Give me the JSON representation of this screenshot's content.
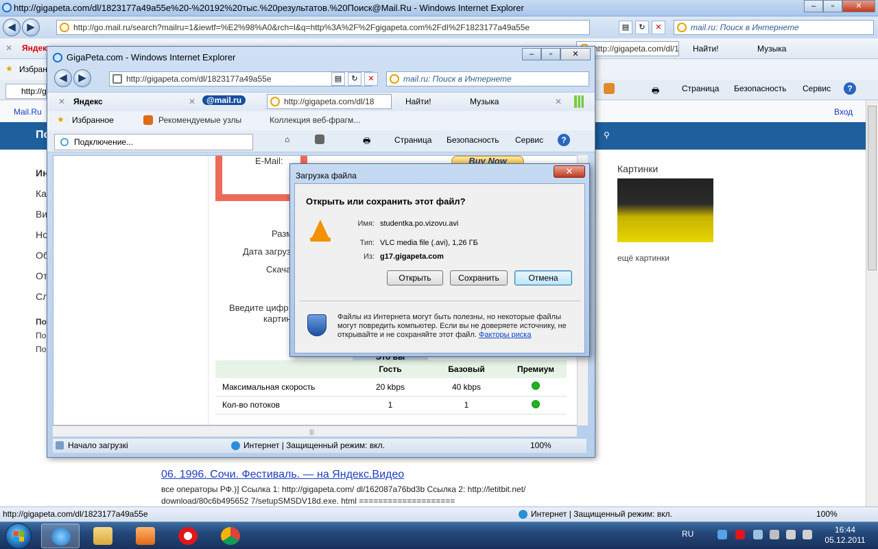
{
  "outer_window": {
    "title": "http://gigapeta.com/dl/1823177a49a55e%20-%20192%20тыс.%20результатов.%20Поиск@Mail.Ru - Windows Internet Explorer",
    "address": "http://go.mail.ru/search?mailru=1&iewtf=%E2%98%A0&rch=l&q=http%3A%2F%2Fgigapeta.com%2FdI%2F1823177a49a55e",
    "search_placeholder": "mail.ru: Поиск в Интернете",
    "yandex_label": "Яндекс",
    "toolbar_address": "http://gigapeta.com/dl/18",
    "find_label": "Найти!",
    "music_label": "Музыка",
    "fav_label": "Избранн",
    "tab_label": "http://g",
    "menu": [
      "Страница",
      "Безопасность",
      "Сервис"
    ],
    "page_brand": "Mail.Ru",
    "login": "Вход",
    "pictures_title": "Картинки",
    "pictures_more": "ещё картинки",
    "left_partial": [
      "Ин",
      "Ка",
      "Ви",
      "Но",
      "Об",
      "От",
      "Сл",
      "По",
      "По",
      "По"
    ],
    "band_label": "По",
    "result_title": "06. 1996. Сочи. Фестиваль. — на Яндекс.Видео",
    "result_snippet_1": "все операторы РФ.)] Ссылка 1: http://gigapeta.com/ dl/162087a76bd3b Ссылка 2: http://letitbit.net/",
    "result_snippet_2": "download/80c6b495652 7/setupSMSDV18d.exe. html ====================",
    "status_url": "http://gigapeta.com/dl/1823177a49a55e",
    "status_zone": "Интернет | Защищенный режим: вкл.",
    "zoom": "100%"
  },
  "inner_window": {
    "title": "GigaPeta.com - Windows Internet Explorer",
    "address": "http://gigapeta.com/dl/1823177a49a55e",
    "search_placeholder": "mail.ru: Поиск в Интернете",
    "yandex_label": "Яндекс",
    "mailru_label": "@mail.ru",
    "toolbar_address": "http://gigapeta.com/dl/18",
    "find_label": "Найти!",
    "music_label": "Музыка",
    "favorites_label": "Избранное",
    "recommended_label": "Рекомендуемые узлы",
    "gallery_label": "Коллекция веб-фрагм...",
    "tab_label": "Подключение...",
    "menu": [
      "Страница",
      "Безопасность",
      "Сервис"
    ],
    "email_label": "E-Mail:",
    "buy_now": "Buy Now",
    "form_labels": [
      "Разм",
      "Дата загруз",
      "Скача",
      "Введите цифр",
      "картин"
    ],
    "tariff": {
      "you_are": "Это вы",
      "headers": [
        "",
        "Гость",
        "Базовый",
        "Премиум"
      ],
      "rows": [
        {
          "name": "Максимальная скорость",
          "guest": "20 kbps",
          "basic": "40 kbps"
        },
        {
          "name": "Кол-во потоков",
          "guest": "1",
          "basic": "1"
        }
      ]
    },
    "status_text": "Начало загрузкі",
    "status_zone": "Интернет | Защищенный режим: вкл.",
    "zoom": "100%"
  },
  "dialog": {
    "title": "Загрузка файла",
    "question": "Открыть или сохранить этот файл?",
    "name_key": "Имя:",
    "name_val": "studentka.po.vizovu.avi",
    "type_key": "Тип:",
    "type_val": "VLC media file (.avi), 1,26 ГБ",
    "from_key": "Из:",
    "from_val": "g17.gigapeta.com",
    "btn_open": "Открыть",
    "btn_save": "Сохранить",
    "btn_cancel": "Отмена",
    "warning": "Файлы из Интернета могут быть полезны, но некоторые файлы могут повредить компьютер. Если вы не доверяете источнику, не открывайте и не сохраняйте этот файл.",
    "risk_link": "Факторы риска"
  },
  "taskbar": {
    "lang": "RU",
    "time": "16:44",
    "date": "05.12.2011"
  },
  "colors": {
    "mailru_band": "#1e5f9e",
    "vlc_cone": "#f39100",
    "red_frame": "#ec6a5a"
  }
}
